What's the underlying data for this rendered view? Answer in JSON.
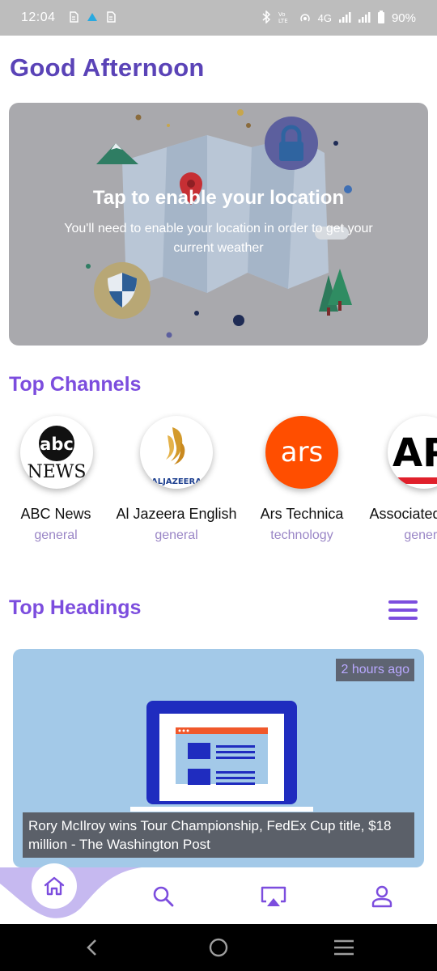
{
  "status_bar": {
    "time": "12:04",
    "network": "4G",
    "battery": "90%",
    "icons": [
      "sim-icon",
      "warning-icon",
      "sim-icon",
      "bluetooth-icon",
      "volte-icon",
      "hotspot-icon",
      "signal-icon",
      "battery-icon"
    ]
  },
  "greeting": "Good Afternoon",
  "location": {
    "title": "Tap to enable your location",
    "subtitle": "You'll need to enable your location in order to get your current weather"
  },
  "channels": {
    "title": "Top Channels",
    "items": [
      {
        "name": "ABC News",
        "category": "general",
        "logo_text": [
          "abc",
          "NEWS"
        ]
      },
      {
        "name": "Al Jazeera English",
        "category": "general",
        "logo_text": [
          "ALJAZEERA"
        ]
      },
      {
        "name": "Ars Technica",
        "category": "technology",
        "logo_text": [
          "ars"
        ]
      },
      {
        "name": "Associated Press",
        "category": "general",
        "logo_text": [
          "AP"
        ]
      }
    ]
  },
  "headings": {
    "title": "Top Headings",
    "articles": [
      {
        "time": "2 hours ago",
        "title": "Rory McIlroy wins Tour Championship, FedEx Cup title, $18 million - The Washington Post"
      }
    ]
  },
  "bottom_nav": {
    "items": [
      "home-icon",
      "search-icon",
      "airplay-icon",
      "profile-icon"
    ],
    "active": "home"
  },
  "colors": {
    "primary": "#7c4dde",
    "greeting": "#5a43b7",
    "category": "#9a86c6",
    "status_bar": "#bdbdbd",
    "nav_wave": "#c6b9f0"
  }
}
